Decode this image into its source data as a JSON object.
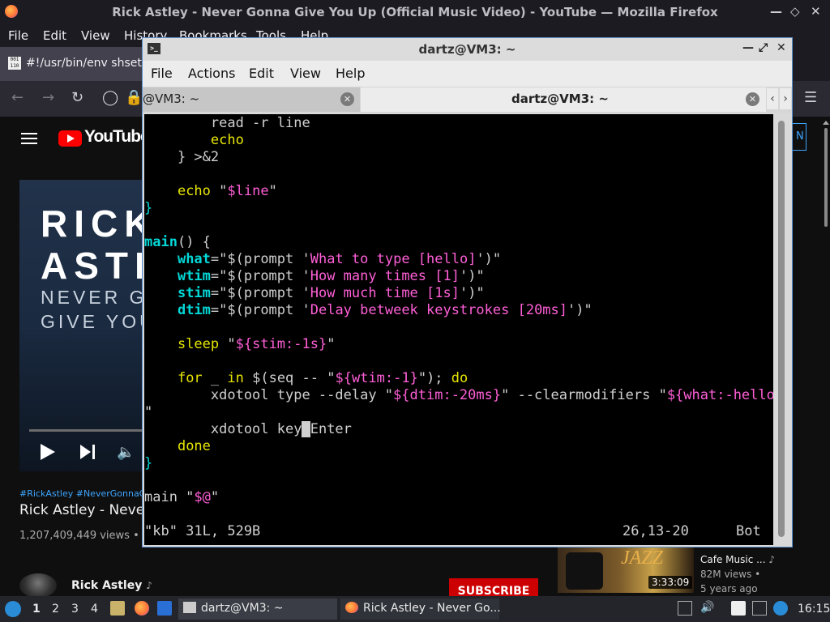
{
  "firefox": {
    "window_title": "Rick Astley - Never Gonna Give You Up (Official Music Video) - YouTube — Mozilla Firefox",
    "menu": [
      "File",
      "Edit",
      "View",
      "History",
      "Bookmarks",
      "Tools",
      "Help"
    ],
    "tab_label": "#!/usr/bin/env shset -"
  },
  "youtube": {
    "logo_text": "YouTube",
    "thumb_line1": "RICK",
    "thumb_line2": "ASTLEY",
    "thumb_line3": "NEVER GONNA",
    "thumb_line4": "GIVE YOU UP",
    "hashtags": "#RickAstley #NeverGonnaGiveYouUp",
    "video_title": "Rick Astley - Never Gonna Give You Up",
    "views": "1,207,409,449 views • Oct",
    "channel": "Rick Astley",
    "subscribe": "SUBSCRIBE",
    "right_edge_text": "N",
    "reco": {
      "thumb_text": "JAZZ",
      "duration": "3:33:09",
      "title": "Cafe Music ...",
      "views": "82M views •",
      "age": "5 years ago"
    }
  },
  "terminal": {
    "title": "dartz@VM3: ~",
    "menu": [
      "File",
      "Actions",
      "Edit",
      "View",
      "Help"
    ],
    "tabs": [
      {
        "label": "@VM3: ~",
        "active": false
      },
      {
        "label": "dartz@VM3: ~",
        "active": true
      }
    ],
    "status_left": "\"kb\" 31L, 529B",
    "status_pos": "26,13-20",
    "status_right": "Bot"
  },
  "taskbar": {
    "workspaces": [
      "1",
      "2",
      "3",
      "4"
    ],
    "apps": [
      {
        "label": "dartz@VM3: ~",
        "icon": "terminal-icon"
      },
      {
        "label": "Rick Astley - Never Go...",
        "icon": "firefox-icon"
      }
    ],
    "clock": "16:15"
  }
}
